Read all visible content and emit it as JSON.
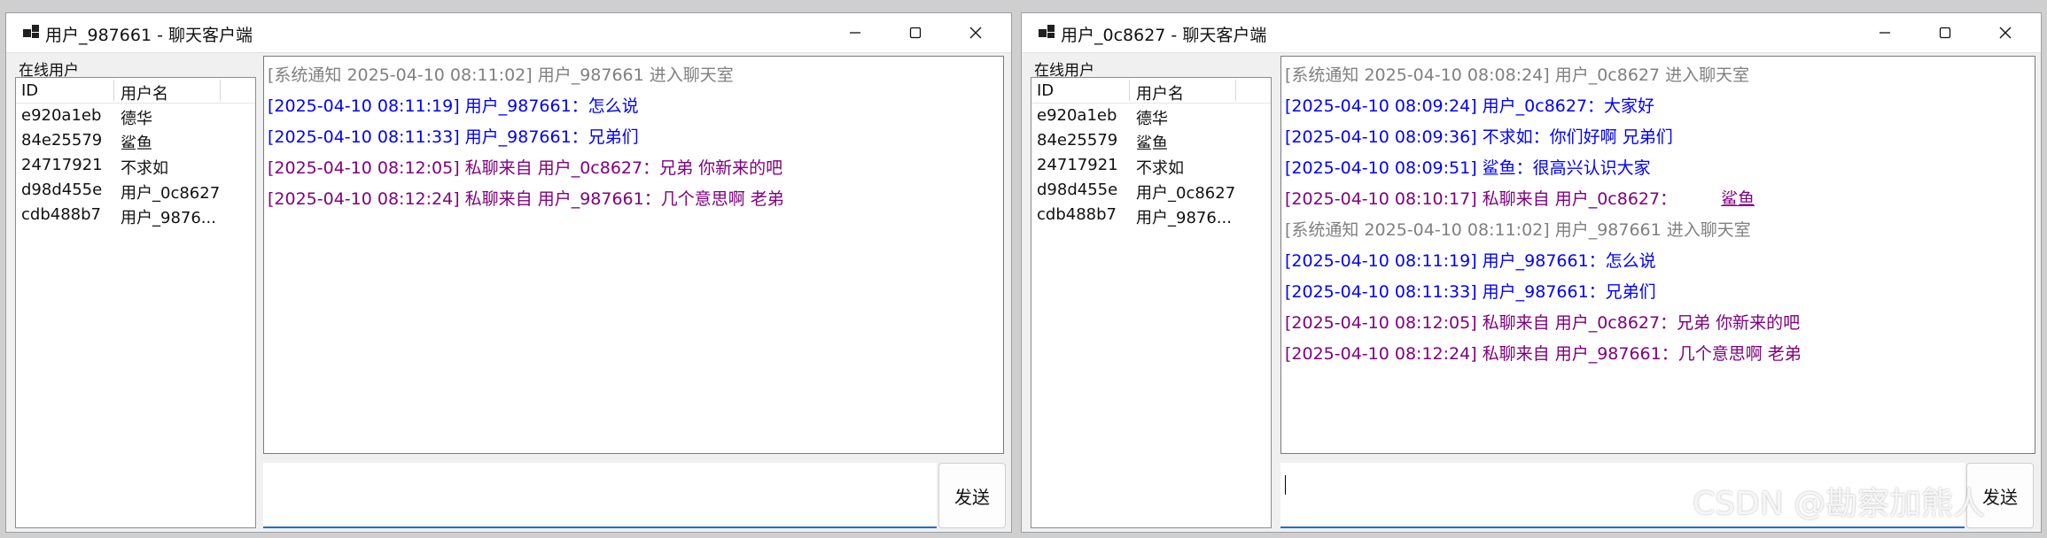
{
  "windows": [
    {
      "title": "用户_987661 - 聊天客户端",
      "online_group_label": "在线用户",
      "columns": [
        "ID",
        "用户名"
      ],
      "users": [
        {
          "id": "e920a1eb",
          "name": "德华"
        },
        {
          "id": "84e25579",
          "name": "鲨鱼"
        },
        {
          "id": "24717921",
          "name": "不求如"
        },
        {
          "id": "d98d455e",
          "name": "用户_0c8627"
        },
        {
          "id": "cdb488b7",
          "name": "用户_9876..."
        }
      ],
      "messages": [
        {
          "type": "sys",
          "text": "[系统通知 2025-04-10 08:11:02] 用户_987661 进入聊天室"
        },
        {
          "type": "pub",
          "text": "[2025-04-10 08:11:19] 用户_987661：怎么说"
        },
        {
          "type": "pub",
          "text": "[2025-04-10 08:11:33] 用户_987661：兄弟们"
        },
        {
          "type": "priv",
          "text": "[2025-04-10 08:12:05] 私聊来自 用户_0c8627：兄弟 你新来的吧"
        },
        {
          "type": "priv",
          "text": "[2025-04-10 08:12:24] 私聊来自 用户_987661：几个意思啊 老弟"
        }
      ],
      "input_value": "",
      "send_label": "发送"
    },
    {
      "title": "用户_0c8627 - 聊天客户端",
      "online_group_label": "在线用户",
      "columns": [
        "ID",
        "用户名"
      ],
      "users": [
        {
          "id": "e920a1eb",
          "name": "德华"
        },
        {
          "id": "84e25579",
          "name": "鲨鱼"
        },
        {
          "id": "24717921",
          "name": "不求如"
        },
        {
          "id": "d98d455e",
          "name": "用户_0c8627"
        },
        {
          "id": "cdb488b7",
          "name": "用户_9876..."
        }
      ],
      "messages": [
        {
          "type": "sys",
          "text": "[系统通知 2025-04-10 08:08:24] 用户_0c8627 进入聊天室"
        },
        {
          "type": "pub",
          "text": "[2025-04-10 08:09:24] 用户_0c8627：大家好"
        },
        {
          "type": "pub",
          "text": "[2025-04-10 08:09:36] 不求如：你们好啊 兄弟们"
        },
        {
          "type": "pub",
          "text": "[2025-04-10 08:09:51] 鲨鱼：很高兴认识大家"
        },
        {
          "type": "priv",
          "text": "[2025-04-10 08:10:17] 私聊来自 用户_0c8627：",
          "tail": "鲨鱼"
        },
        {
          "type": "sys",
          "text": "[系统通知 2025-04-10 08:11:02] 用户_987661 进入聊天室"
        },
        {
          "type": "pub",
          "text": "[2025-04-10 08:11:19] 用户_987661：怎么说"
        },
        {
          "type": "pub",
          "text": "[2025-04-10 08:11:33] 用户_987661：兄弟们"
        },
        {
          "type": "priv",
          "text": "[2025-04-10 08:12:05] 私聊来自 用户_0c8627：兄弟 你新来的吧"
        },
        {
          "type": "priv",
          "text": "[2025-04-10 08:12:24] 私聊来自 用户_987661：几个意思啊 老弟"
        }
      ],
      "input_value": "",
      "send_label": "发送"
    }
  ],
  "watermark": "CSDN @勘察加熊人",
  "colors": {
    "system_message": "#808080",
    "public_message": "#0000ff",
    "private_message": "#800080",
    "input_accent": "#1c6fd1"
  }
}
